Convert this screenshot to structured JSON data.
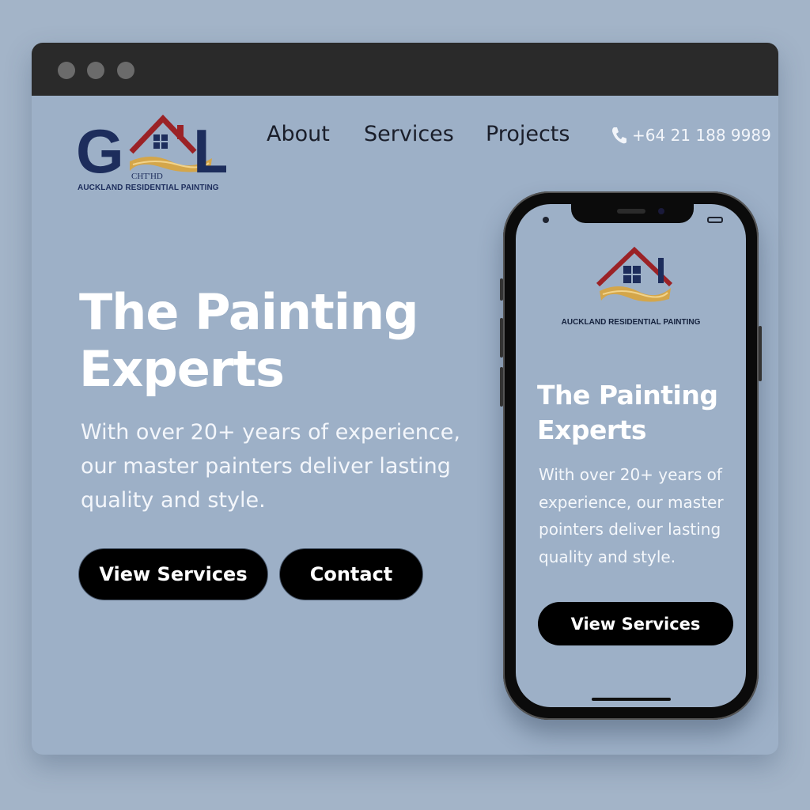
{
  "window": {
    "controls": [
      "close",
      "minimize",
      "maximize"
    ]
  },
  "logo": {
    "letters": "G L",
    "tag": "CHT'HD",
    "caption": "AUCKLAND RESIDENTIAL PAINTING",
    "colors": {
      "navy": "#1d2d5c",
      "roof": "#9b2226",
      "gold": "#d4a64a"
    }
  },
  "nav": {
    "items": [
      {
        "label": "About"
      },
      {
        "label": "Services"
      },
      {
        "label": "Projects"
      }
    ],
    "phone": "+64 21 188 9989"
  },
  "hero": {
    "title_line1": "The Painting",
    "title_line2": "Experts",
    "body": "With over 20+ years of experience, our master painters deliver lasting quality and style.",
    "buttons": {
      "primary": "View Services",
      "secondary": "Contact"
    }
  },
  "mobile": {
    "caption": "AUCKLAND RESIDENTIAL PAINTING",
    "title_line1": "The Painting",
    "title_line2": "Experts",
    "body": "With over 20+ years of experience, our master pointers deliver lasting quality and style.",
    "button": "View Services"
  },
  "colors": {
    "background": "#9db0c7",
    "titlebar": "#2a2a2a",
    "button": "#000000",
    "heading": "#ffffff"
  }
}
